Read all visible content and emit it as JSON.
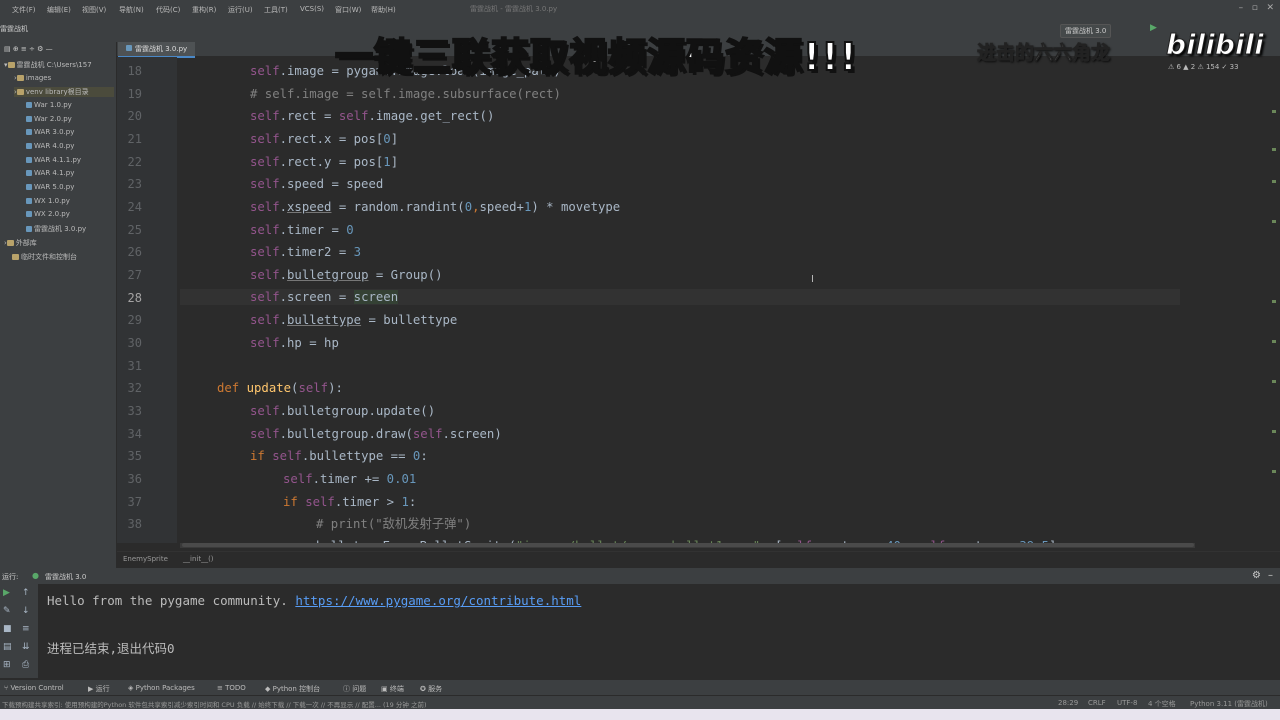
{
  "menu": [
    "文件(F)",
    "编辑(E)",
    "视图(V)",
    "导航(N)",
    "代码(C)",
    "重构(R)",
    "运行(U)",
    "工具(T)",
    "VCS(S)",
    "窗口(W)",
    "帮助(H)"
  ],
  "window_title": "雷霆战机 - 雷霆战机 3.0.py",
  "project_crumb": "雷霆战机",
  "run_config": "雷霆战机 3.0",
  "project_tree": [
    {
      "label": "雷霆战机  C:\\Users\\157",
      "type": "folder"
    },
    {
      "label": "images",
      "type": "folder"
    },
    {
      "label": "venv  library根目录",
      "type": "folder"
    },
    {
      "label": "War 1.0.py",
      "type": "py"
    },
    {
      "label": "War 2.0.py",
      "type": "py"
    },
    {
      "label": "WAR 3.0.py",
      "type": "py"
    },
    {
      "label": "WAR 4.0.py",
      "type": "py"
    },
    {
      "label": "WAR 4.1.1.py",
      "type": "py"
    },
    {
      "label": "WAR 4.1.py",
      "type": "py"
    },
    {
      "label": "WAR 5.0.py",
      "type": "py"
    },
    {
      "label": "WX 1.0.py",
      "type": "py"
    },
    {
      "label": "WX 2.0.py",
      "type": "py"
    },
    {
      "label": "雷霆战机 3.0.py",
      "type": "py"
    },
    {
      "label": "外部库",
      "type": "folder"
    },
    {
      "label": "临时文件和控制台",
      "type": "folder"
    }
  ],
  "editor_tab": "雷霆战机 3.0.py",
  "inspections": "⚠ 6  ▲ 2  ⚠ 154  ✓ 33",
  "line_numbers": [
    "18",
    "19",
    "20",
    "21",
    "22",
    "23",
    "24",
    "25",
    "26",
    "27",
    "28",
    "29",
    "30",
    "31",
    "32",
    "33",
    "34",
    "35",
    "36",
    "37",
    "38"
  ],
  "current_line": "28",
  "breadcrumbs": [
    "EnemySprite",
    "__init__()"
  ],
  "run_panel": {
    "title_prefix": "运行:",
    "config": "雷霆战机 3.0",
    "output_text": "Hello from the pygame community. ",
    "output_link": "https://www.pygame.org/contribute.html",
    "exit_text": "进程已结束,退出代码0"
  },
  "tool_windows": [
    "Version Control",
    "运行",
    "Python Packages",
    "TODO",
    "Python 控制台",
    "问题",
    "终端",
    "服务"
  ],
  "status": {
    "message": "下载预构建共享索引: 使用预构建的Python 软件包共享索引减少索引时间和 CPU 负载 // 始终下载 // 下载一次 // 不再显示 // 配置... (19 分钟 之前)",
    "position": "28:29",
    "line_sep": "CRLF",
    "encoding": "UTF-8",
    "indent": "4 个空格",
    "interpreter": "Python 3.11 (雷霆战机)"
  },
  "overlay": {
    "banner": "一键三联获取视频源码资源!!!",
    "channel": "进击的六六角龙",
    "logo": "bilibili"
  },
  "colors": {
    "keyword": "#cc7832",
    "self": "#94558d",
    "number": "#6897bb",
    "function": "#ffc66d",
    "comment": "#808080",
    "string": "#6a8759"
  }
}
